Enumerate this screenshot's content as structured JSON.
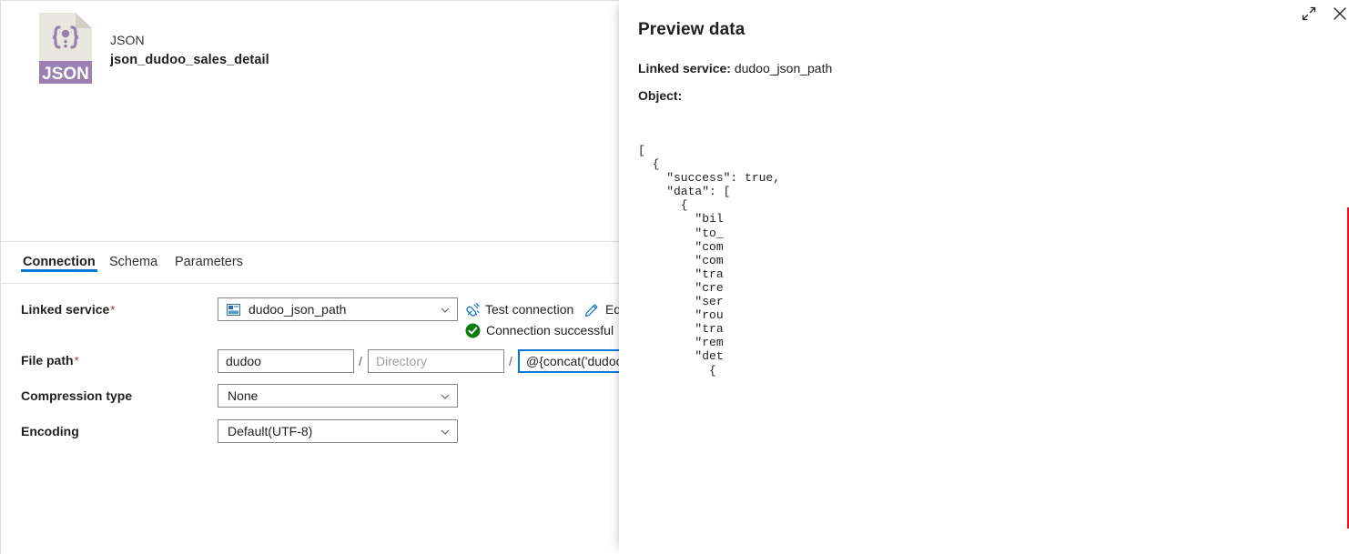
{
  "dataset": {
    "type_label": "JSON",
    "name": "json_dudoo_sales_detail",
    "icon_badge_text": "JSON",
    "icon_glyph": "{ }",
    "icon_name": "json-file-icon"
  },
  "tabs": [
    {
      "label": "Connection",
      "active": true
    },
    {
      "label": "Schema",
      "active": false
    },
    {
      "label": "Parameters",
      "active": false
    }
  ],
  "form": {
    "linked_service": {
      "label": "Linked service",
      "required_marker": "*",
      "value": "dudoo_json_path",
      "icon": "linked-service-icon",
      "chevron": "chevron-down-icon"
    },
    "test_connection": {
      "label": "Test connection",
      "icon": "plug-test-connection-icon"
    },
    "edit_link": {
      "label": "Ed",
      "icon": "pencil-edit-icon"
    },
    "connection_status": {
      "text": "Connection successful",
      "icon": "green-check-circle-icon",
      "color": "#107c10"
    },
    "file_path": {
      "label": "File path",
      "required_marker": "*",
      "container_value": "dudoo",
      "directory_placeholder": "Directory",
      "directory_value": "",
      "file_name_value": "@{concat('dudoo_",
      "separator": "/"
    },
    "compression_type": {
      "label": "Compression type",
      "value": "None",
      "chevron": "chevron-down-icon"
    },
    "encoding": {
      "label": "Encoding",
      "value": "Default(UTF-8)",
      "chevron": "chevron-down-icon"
    }
  },
  "preview_panel": {
    "title": "Preview data",
    "expand_icon": "expand-diagonal-icon",
    "close_icon": "close-icon",
    "linked_service_label": "Linked service:",
    "linked_service_value": "dudoo_json_path",
    "object_label": "Object:",
    "json_text": "[\n  {\n    \"success\": true,\n    \"data\": [\n      {\n        \"bil\n        \"to_\n        \"com\n        \"com\n        \"tra\n        \"cre\n        \"ser\n        \"rou\n        \"tra\n        \"rem\n        \"det\n          {",
    "trailing_comma": ",",
    "redaction": {
      "name": "red-annotation-rectangle",
      "color": "#fa0a07"
    }
  }
}
